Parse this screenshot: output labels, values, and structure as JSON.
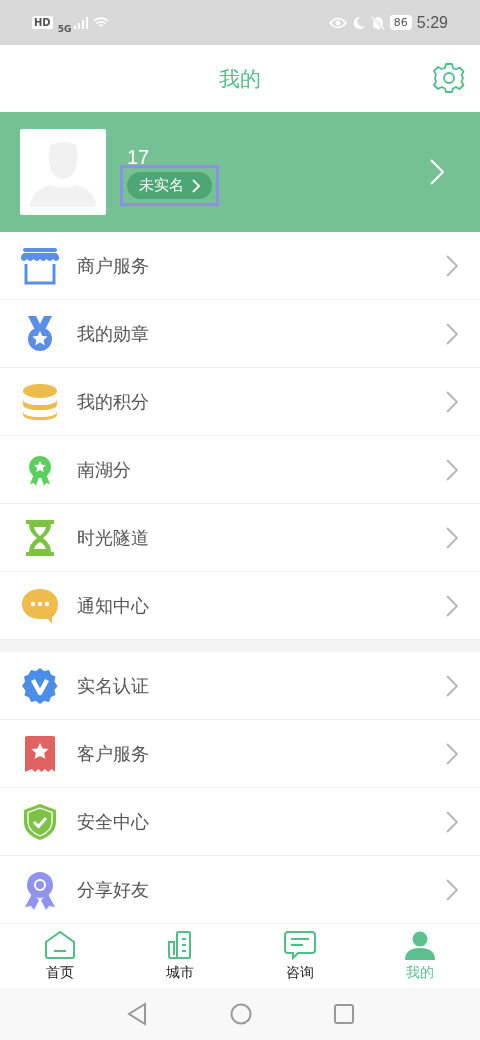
{
  "status_bar": {
    "hd": "HD",
    "network": "5G",
    "battery": "86",
    "time": "5:29"
  },
  "header": {
    "title": "我的"
  },
  "profile": {
    "name": "17",
    "badge": {
      "label": "未实名",
      "highlighted": true
    }
  },
  "menu_groups": [
    [
      {
        "label": "商户服务"
      },
      {
        "label": "我的勋章"
      },
      {
        "label": "我的积分"
      },
      {
        "label": "南湖分"
      },
      {
        "label": "时光隧道"
      },
      {
        "label": "通知中心"
      }
    ],
    [
      {
        "label": "实名认证"
      },
      {
        "label": "客户服务"
      },
      {
        "label": "安全中心"
      },
      {
        "label": "分享好友"
      }
    ]
  ],
  "tabs": [
    {
      "label": "首页",
      "selected": false
    },
    {
      "label": "城市",
      "selected": false
    },
    {
      "label": "咨询",
      "selected": false
    },
    {
      "label": "我的",
      "selected": true
    }
  ]
}
